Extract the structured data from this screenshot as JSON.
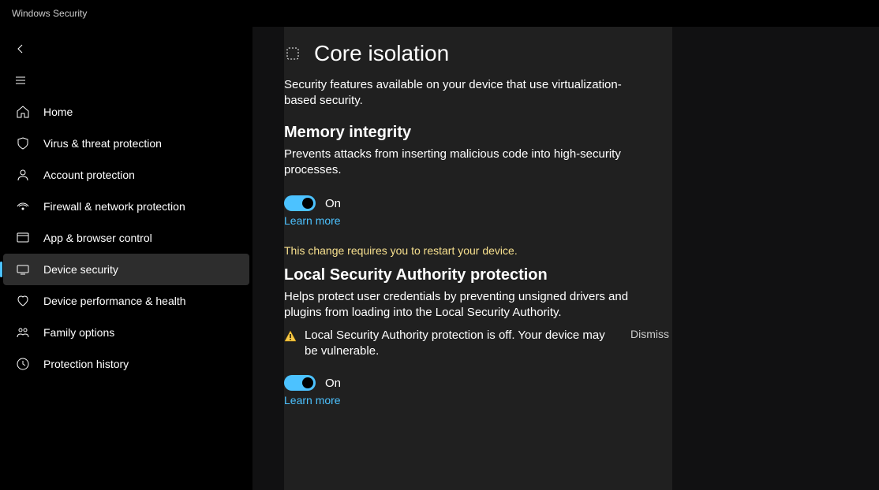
{
  "window_title": "Windows Security",
  "sidebar": {
    "items": [
      {
        "label": "Home",
        "icon": "home-icon"
      },
      {
        "label": "Virus & threat protection",
        "icon": "shield-icon"
      },
      {
        "label": "Account protection",
        "icon": "account-icon"
      },
      {
        "label": "Firewall & network protection",
        "icon": "network-icon"
      },
      {
        "label": "App & browser control",
        "icon": "appbrowser-icon"
      },
      {
        "label": "Device security",
        "icon": "device-icon"
      },
      {
        "label": "Device performance & health",
        "icon": "health-icon"
      },
      {
        "label": "Family options",
        "icon": "family-icon"
      },
      {
        "label": "Protection history",
        "icon": "history-icon"
      }
    ],
    "active_index": 5
  },
  "page": {
    "title": "Core isolation",
    "description": "Security features available on your device that use virtualization-based security.",
    "sections": [
      {
        "title": "Memory integrity",
        "description": "Prevents attacks from inserting malicious code into high-security processes.",
        "toggle_state": "On",
        "learn_more": "Learn more",
        "restart_msg": "This change requires you to restart your device."
      },
      {
        "title": "Local Security Authority protection",
        "description": "Helps protect user credentials by preventing unsigned drivers and plugins from loading into the Local Security Authority.",
        "warning": "Local Security Authority protection is off. Your device may be vulnerable.",
        "dismiss": "Dismiss",
        "toggle_state": "On",
        "learn_more": "Learn more"
      }
    ]
  },
  "colors": {
    "accent": "#4cc2ff",
    "warning_text": "#f7e08e"
  }
}
